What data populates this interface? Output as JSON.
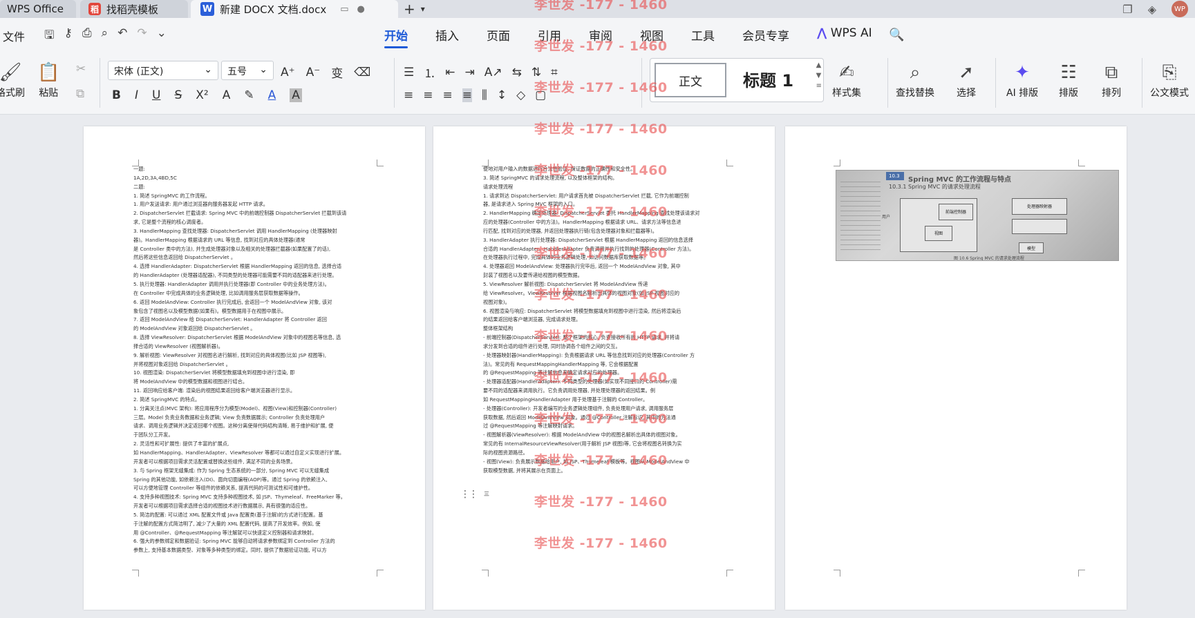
{
  "tabs": {
    "wps_office": "WPS Office",
    "template": "找稻壳模板",
    "document": "新建 DOCX 文档.docx",
    "daoke_icon_text": "稻",
    "word_icon_text": "W",
    "avatar_text": "WP"
  },
  "menu": {
    "file": "文件",
    "tabs": [
      "开始",
      "插入",
      "页面",
      "引用",
      "审阅",
      "视图",
      "工具",
      "会员专享"
    ],
    "wps_ai": "WPS AI"
  },
  "ribbon": {
    "format_painter": "格式刷",
    "paste": "粘贴",
    "font_name": "宋体 (正文)",
    "font_size": "五号",
    "style_normal": "正文",
    "style_heading": "标题 1",
    "style_set": "样式集",
    "find_replace": "查找替换",
    "select": "选择",
    "ai_layout": "AI 排版",
    "layout": "排版",
    "arrange": "排列",
    "doc_mode": "公文模式"
  },
  "watermark": "李世发 -177 - 1460",
  "page1_lines": [
    "一题:",
    "1A,2D,3A,4BD,5C",
    "二题:",
    "1. 简述 SpringMVC 的工作流程。",
    "1. 用户发送请求: 用户通过浏览器向服务器发起 HTTP 请求。",
    "2. DispatcherServlet 拦截请求: Spring MVC 中的前端控制器 DispatcherServlet 拦截到该请",
    "求, 它是整个流程的核心调度者。",
    "3. HandlerMapping 查找处理器: DispatcherServlet 调用 HandlerMapping (处理器映射",
    "器)。HandlerMapping 根据请求的 URL 等信息, 找到对应的具体处理器(通常",
    "是 Controller 类中的方法), 并生成处理器对象以及相关的处理器拦截器(如果配置了的话),",
    "然后将这些信息返回给 DispatcherServlet 。",
    "4. 选择 HandlerAdapter: DispatcherServlet 根据 HandlerMapping 返回的信息, 选择合适",
    "的 HandlerAdapter (处理器适配器), 不同类型的处理器可能需要不同的适配器来进行处理。",
    "5. 执行处理器: HandlerAdapter 调用并执行处理器(即 Controller 中的业务处理方法)。",
    "在 Controller 中完成具体的业务逻辑处理, 比如调用服务层获取数据等操作。",
    "6. 返回 ModelAndView: Controller 执行完成后, 会返回一个 ModelAndView 对象, 该对",
    "象包含了视图名以及模型数据(如果有)。模型数据用于在视图中展示。",
    "7. 返回 ModelAndView 给 DispatcherServlet: HandlerAdapter 将 Controller 返回",
    "的 ModelAndView 对象返回给 DispatcherServlet 。",
    "8. 选择 ViewResolver: DispatcherServlet 根据 ModelAndView 对象中的视图名等信息, 选",
    "择合适的 ViewResolver (视图解析器)。",
    "9. 解析视图: ViewResolver 对视图名进行解析, 找到对应的具体视图(比如 JSP 视图等),",
    "并将视图对象返回给 DispatcherServlet 。",
    "10. 视图渲染: DispatcherServlet 将模型数据填充到视图中进行渲染, 即",
    "将 ModelAndView 中的模型数据和视图进行结合。",
    "11. 返回响应给客户端: 渲染后的视图结果返回给客户端浏览器进行显示。",
    "2. 简述 SpringMVC 的特点。",
    "1. 分离关注点(MVC 架构): 将应用程序分为模型(Model)、视图(View)和控制器(Controller)",
    "三层。Model 负责业务数据和业务逻辑; View 负责数据展示; Controller 负责处理用户",
    "请求、调用业务逻辑并决定返回哪个视图。这种分离使得代码结构清晰, 易于维护和扩展, 便",
    "于团队分工开发。",
    "2. 灵活性和可扩展性: 提供了丰富的扩展点,",
    "如 HandlerMapping、HandlerAdapter、ViewResolver 等都可以通过自定义实现进行扩展。",
    "开发者可以根据项目需求灵活配置或替换这些组件, 满足不同的业务场景。",
    "3. 与 Spring 框架无缝集成: 作为 Spring 生态系统的一部分, Spring MVC 可以无缝集成",
    "Spring 的其他功能, 如依赖注入(DI)、面向切面编程(AOP)等。通过 Spring 的依赖注入,",
    "可以方便地管理 Controller 等组件的依赖关系, 提高代码的可测试性和可维护性。",
    "4. 支持多种视图技术: Spring MVC 支持多种视图技术, 如 JSP、Thymeleaf、FreeMarker 等。",
    "开发者可以根据项目需求选择合适的视图技术进行数据展示, 具有很强的适应性。",
    "5. 简洁的配置: 可以通过 XML 配置文件或 Java 配置类(基于注解)的方式进行配置。基",
    "于注解的配置方式简洁明了, 减少了大量的 XML 配置代码, 提高了开发效率。例如, 使",
    "用 @Controller、@RequestMapping 等注解就可以快速定义控制器和请求映射。",
    "6. 强大的参数绑定和数据验证: Spring MVC 能够自动将请求参数绑定到 Controller 方法的",
    "参数上, 支持基本数据类型、对象等多种类型的绑定。同时, 提供了数据验证功能, 可以方"
  ],
  "page2_lines": [
    "便地对用户输入的数据进行合法性验证, 保证数据的正确性和安全性。",
    "3. 简述 SpringMVC 的请求处理流程, 以及整体框架的结构。",
    "请求处理流程",
    "1. 请求到达 DispatcherServlet: 用户请求首先被 DispatcherServlet 拦截, 它作为前端控制",
    "器, 是请求进入 Spring MVC 框架的入口。",
    "2. HandlerMapping 确定处理器: DispatcherServlet 委托 HandlerMapping 查找处理该请求对",
    "应的处理器(Controller 中的方法)。HandlerMapping 根据请求 URL、请求方法等信息进",
    "行匹配, 找到对应的处理器, 并返回处理器执行链(包含处理器对象和拦截器等)。",
    "3. HandlerAdapter 执行处理器: DispatcherServlet 根据 HandlerMapping 返回的信息选择",
    "合适的 HandlerAdapter。HandlerAdapter 负责调用并执行找到的处理器(Controller 方法)。",
    "在处理器执行过程中, 完成具体的业务逻辑处理, 如访问数据库获取数据等。",
    "4. 处理器返回 ModelAndView: 处理器执行完毕后, 返回一个 ModelAndView 对象, 其中",
    "封装了视图名以及要传递给视图的模型数据。",
    "5. ViewResolver 解析视图: DispatcherServlet 将 ModelAndView 传递",
    "给 ViewResolver。ViewResolver 根据视图名解析出具体的视图对象(如 JSP 视图对应的",
    "视图对象)。",
    "6. 视图渲染与响应: DispatcherServlet 将模型数据填充到视图中进行渲染, 然后将渲染后",
    "的结果返回给客户端浏览器, 完成请求处理。",
    "整体框架结构",
    "- 前端控制器(DispatcherServlet): 整个框架的核心, 负责接收所有的 HTTP 请求, 并将请",
    "求分发到合适的组件进行处理, 同时协调各个组件之间的交互。",
    "- 处理器映射器(HandlerMapping): 负责根据请求 URL 等信息找到对应的处理器(Controller 方",
    "法)。常见的有 RequestMappingHandlerMapping 等, 它会根据配置",
    "的 @RequestMapping 等注解信息来确定请求对应的处理器。",
    "- 处理器适配器(HandlerAdapter): 不同类型的处理器(如实现不同接口的 Controller)需",
    "要不同的适配器来调用执行。它负责调用处理器, 并处理处理器的返回结果。例",
    "如 RequestMappingHandlerAdapter 用于处理基于注解的 Controller。",
    "- 处理器(Controller): 开发者编写的业务逻辑处理组件, 负责处理用户请求, 调用服务层",
    "获取数据, 然后返回 ModelAndView 对象。通过 @Controller 注解标识, 其中的方法通",
    "过 @RequestMapping 等注解映射请求。",
    "- 视图解析器(ViewResolver): 根据 ModelAndView 中的视图名解析出具体的视图对象。",
    "常见的有 InternalResourceViewResolver(用于解析 JSP 视图)等, 它会将视图名转换为实",
    "际的视图资源路径。",
    "- 视图(View): 负责展示数据给用户, 如 JSP、Thymeleaf 模板等。视图从 ModelAndView 中",
    "获取模型数据, 并将其展示在页面上。"
  ],
  "page2_tail": "三",
  "photo": {
    "badge": "10.3",
    "title": "Spring MVC 的工作流程与特点",
    "subtitle": "10.3.1  Spring MVC 的请求处理流程",
    "user": "用户",
    "box_core": "前端控制器",
    "box_mapper": "处理器映射器",
    "box_view": "视图",
    "box_model": "模型",
    "caption": "图 10.6  Spring MVC 的请求处理流程"
  },
  "colors": {
    "accent": "#1f5bd8",
    "watermark": "#e85050",
    "ai": "#5b4cf0"
  }
}
